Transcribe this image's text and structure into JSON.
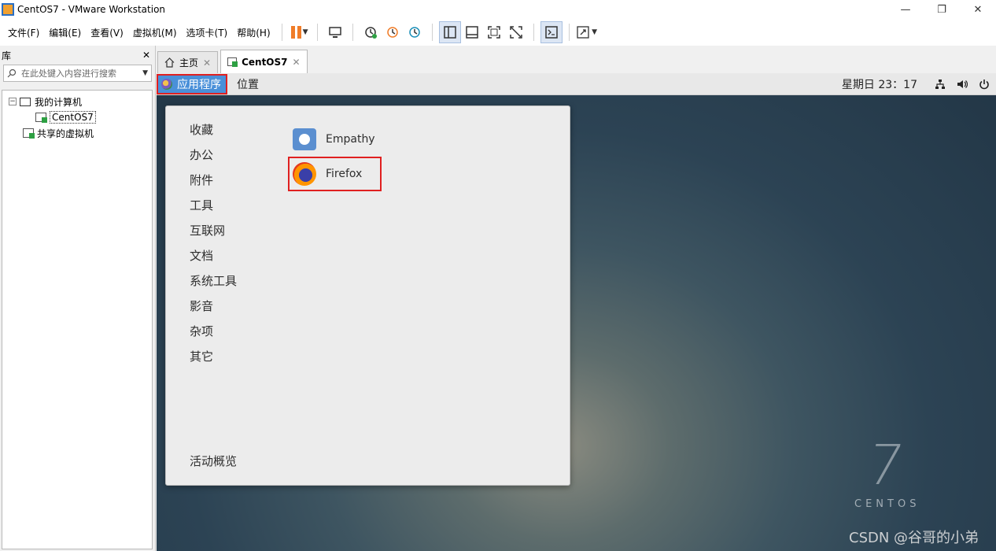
{
  "window": {
    "title": "CentOS7 - VMware Workstation",
    "controls": [
      "—",
      "❐",
      "✕"
    ]
  },
  "menubar": {
    "items": [
      "文件(F)",
      "编辑(E)",
      "查看(V)",
      "虚拟机(M)",
      "选项卡(T)",
      "帮助(H)"
    ]
  },
  "library": {
    "title": "库",
    "close": "✕",
    "search_placeholder": "在此处键入内容进行搜索",
    "tree": {
      "root": "我的计算机",
      "vm": "CentOS7",
      "shared": "共享的虚拟机"
    }
  },
  "tabs": [
    {
      "label": "主页",
      "close": "✕"
    },
    {
      "label": "CentOS7",
      "close": "✕"
    }
  ],
  "guest": {
    "topbar": {
      "applications": "应用程序",
      "places": "位置",
      "clock": "星期日 23：17"
    },
    "app_menu": {
      "categories": [
        "收藏",
        "办公",
        "附件",
        "工具",
        "互联网",
        "文档",
        "系统工具",
        "影音",
        "杂项",
        "其它"
      ],
      "overview": "活动概览",
      "apps": [
        "Empathy",
        "Firefox"
      ]
    },
    "brand": {
      "version": "7",
      "name": "CENTOS"
    },
    "watermark": "CSDN @谷哥的小弟"
  },
  "colors": {
    "highlight_red": "#e02020",
    "apps_blue": "#4a90d9",
    "pause_orange": "#f07c28"
  }
}
